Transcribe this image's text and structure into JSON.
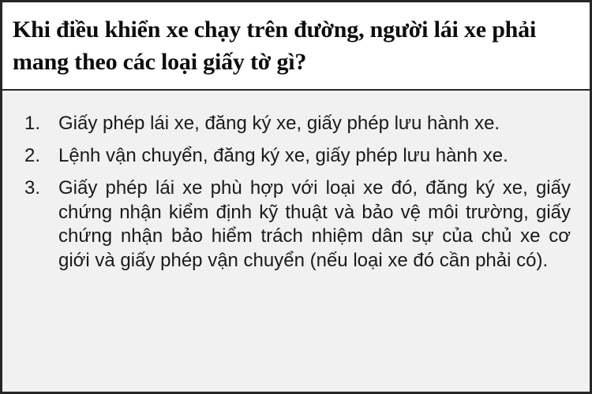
{
  "question": "Khi điều khiển xe chạy trên đường, người lái xe phải mang theo các loại giấy tờ gì?",
  "answers": [
    {
      "number": "1.",
      "text": "Giấy phép lái xe, đăng ký xe, giấy phép lưu hành xe."
    },
    {
      "number": "2.",
      "text": "Lệnh vận chuyển, đăng ký xe, giấy phép lưu hành xe."
    },
    {
      "number": "3.",
      "text": "Giấy phép lái xe phù hợp với loại xe đó, đăng ký xe, giấy chứng nhận kiểm định kỹ thuật và bảo vệ môi trường, giấy chứng nhận bảo hiểm trách nhiệm dân sự của chủ xe cơ giới và giấy phép vận chuyển  (nếu loại xe đó cần phải có)."
    }
  ]
}
